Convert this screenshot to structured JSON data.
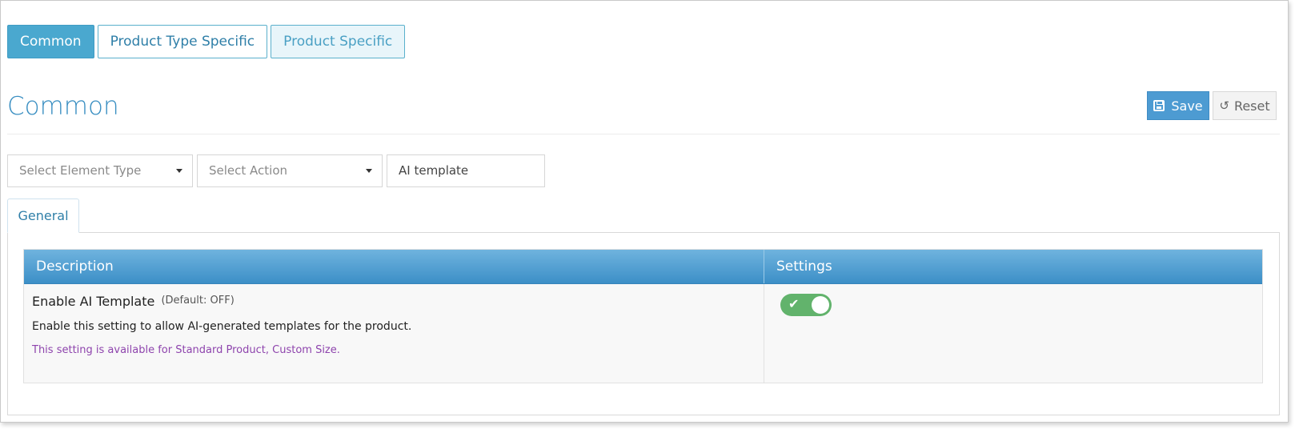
{
  "top_tabs": [
    {
      "label": "Common",
      "state": "active"
    },
    {
      "label": "Product Type Specific",
      "state": "outline"
    },
    {
      "label": "Product Specific",
      "state": "light"
    }
  ],
  "header": {
    "title": "Common",
    "save_label": "Save",
    "reset_label": "Reset"
  },
  "filters": {
    "element_type_placeholder": "Select Element Type",
    "action_placeholder": "Select Action",
    "search_value": "AI template"
  },
  "inner_tabs": [
    {
      "label": "General",
      "active": true
    }
  ],
  "table": {
    "columns": [
      "Description",
      "Settings"
    ],
    "rows": [
      {
        "name": "Enable AI Template",
        "default": "(Default: OFF)",
        "description": "Enable this setting to allow AI-generated templates for the product.",
        "note": "This setting is available for Standard Product, Custom Size.",
        "toggle_on": true
      }
    ]
  },
  "colors": {
    "accent": "#4aa8cf",
    "title": "#3a8fc2",
    "header_gradient_top": "#6fb3de",
    "header_gradient_bottom": "#3c8fc7",
    "toggle_on": "#62b36c",
    "note": "#8e44ad"
  },
  "icons": {
    "save": "floppy-disk-icon",
    "reset": "undo-icon",
    "dropdown": "caret-down-icon",
    "toggle_check": "check-icon"
  }
}
